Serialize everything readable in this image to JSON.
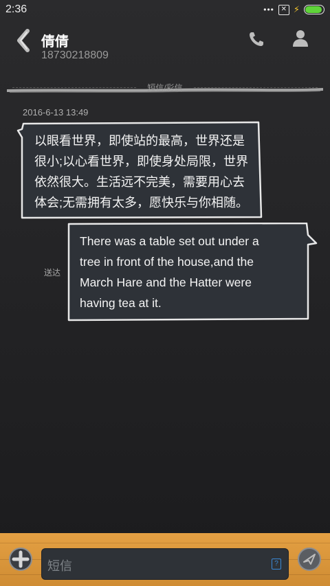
{
  "status_bar": {
    "time": "2:36",
    "icons": [
      "dots-icon",
      "no-sim-icon",
      "charging-bolt-icon",
      "battery-icon"
    ],
    "battery_level": 1.0
  },
  "header": {
    "contact_name": "倩倩",
    "contact_number": "18730218809"
  },
  "thread": {
    "divider_label": "短信/彩信",
    "timestamp": "2016-6-13 13:49",
    "incoming": {
      "lines": [
        "以眼看世界，即使站的最高，世界还是",
        "很小;以心看世界，即使身处局限，世界",
        "依然很大。生活远不完美，需要用心去",
        "体会;无需拥有太多，愿快乐与你相随。"
      ]
    },
    "outgoing": {
      "lines": [
        "There was a table set out under a",
        "tree in front of the house,and the",
        "March Hare and the Hatter were",
        "having tea at it."
      ],
      "status": "送达"
    }
  },
  "compose": {
    "placeholder": "短信",
    "template_icon_label": "?"
  },
  "colors": {
    "background": "#232325",
    "bubble_fill": "#2e3238",
    "bubble_border": "#e8e8e8",
    "bottom_bar": "#dc9a40",
    "battery": "#5fd43a"
  }
}
